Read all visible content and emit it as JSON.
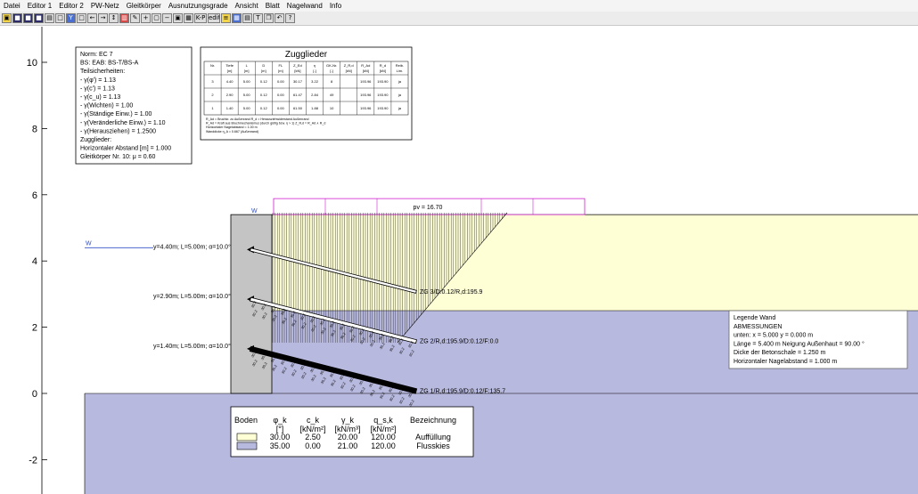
{
  "menu": [
    "Datei",
    "Editor 1",
    "Editor 2",
    "PW-Netz",
    "Gleitkörper",
    "Ausnutzungsgrade",
    "Ansicht",
    "Blatt",
    "Nagelwand",
    "Info"
  ],
  "toolbar_icons": [
    {
      "name": "open-folder-icon",
      "glyph": "▣",
      "style": "yel"
    },
    {
      "name": "save-icon",
      "glyph": "■",
      "style": "dark"
    },
    {
      "name": "save-as-icon",
      "glyph": "■",
      "style": "dark"
    },
    {
      "name": "save-all-icon",
      "glyph": "■",
      "style": "dark"
    },
    {
      "name": "print-icon",
      "glyph": "▤",
      "style": ""
    },
    {
      "name": "page-setup-icon",
      "glyph": "□",
      "style": ""
    },
    {
      "name": "y-tool-icon",
      "glyph": "Y",
      "style": "blue"
    },
    {
      "name": "box-tool-icon",
      "glyph": "□",
      "style": ""
    },
    {
      "name": "move-left-icon",
      "glyph": "←",
      "style": ""
    },
    {
      "name": "move-right-icon",
      "glyph": "→",
      "style": ""
    },
    {
      "name": "fit-icon",
      "glyph": "↕",
      "style": ""
    },
    {
      "name": "layers-icon",
      "glyph": "▥",
      "style": "red"
    },
    {
      "name": "pencil-icon",
      "glyph": "✎",
      "style": ""
    },
    {
      "name": "zoom-in-icon",
      "glyph": "+",
      "style": ""
    },
    {
      "name": "zoom-window-icon",
      "glyph": "▢",
      "style": ""
    },
    {
      "name": "zoom-out-icon",
      "glyph": "−",
      "style": ""
    },
    {
      "name": "zoom-fit-icon",
      "glyph": "▣",
      "style": ""
    },
    {
      "name": "grid-icon",
      "glyph": "▦",
      "style": ""
    },
    {
      "name": "kp-icon",
      "glyph": "K-P",
      "style": "wide"
    },
    {
      "name": "edit-icon",
      "glyph": "edit",
      "style": "wide"
    },
    {
      "name": "soil-layers-icon",
      "glyph": "≡",
      "style": "yel"
    },
    {
      "name": "table-icon",
      "glyph": "▦",
      "style": "blue"
    },
    {
      "name": "chart-icon",
      "glyph": "▤",
      "style": ""
    },
    {
      "name": "t-icon",
      "glyph": "T",
      "style": ""
    },
    {
      "name": "copy-icon",
      "glyph": "❐",
      "style": ""
    },
    {
      "name": "undo-icon",
      "glyph": "↶",
      "style": ""
    },
    {
      "name": "help-icon",
      "glyph": "?",
      "style": ""
    }
  ],
  "norm_box": [
    "Norm:  EC 7",
    "BS: EAB: BS-T/BS-A",
    "Teilsicherheiten:",
    " - γ(φ') = 1.13",
    " - γ(c') = 1.13",
    " - γ(c_u) = 1.13",
    " - γ(Wichten) = 1.00",
    " - γ(Ständige Einw.) = 1.00",
    " - γ(Veränderliche Einw.) = 1.10",
    " - γ(Herausziehen) = 1.2500",
    "Zugglieder:",
    "Horizontaler Abstand [m] = 1.000",
    "Gleitkörper Nr. 10: μ = 0.60"
  ],
  "zugglieder": {
    "title": "Zugglieder",
    "headers": [
      [
        "Nr.",
        ""
      ],
      [
        "Tiefe",
        "[m]"
      ],
      [
        "L",
        "[m]"
      ],
      [
        "D",
        "[m]"
      ],
      [
        "FL",
        "[m]"
      ],
      [
        "Z_Ed",
        "[kN]"
      ],
      [
        "η",
        "[-]"
      ],
      [
        "GK-Nr.",
        "[-]"
      ],
      [
        "Z_R,d",
        "[kN]"
      ],
      [
        "R_Ad",
        "[kN]"
      ],
      [
        "R_d",
        "[kN]"
      ],
      [
        "Reib.",
        "Lim."
      ]
    ],
    "rows": [
      [
        "3",
        "4.40",
        "5.00",
        "0.12",
        "0.00",
        "30.17",
        "3.22",
        "8",
        "",
        "193.96",
        "193.90",
        "ja"
      ],
      [
        "2",
        "2.90",
        "5.00",
        "0.12",
        "0.00",
        "61.47",
        "2.84",
        "49",
        "",
        "193.96",
        "193.90",
        "ja"
      ],
      [
        "1",
        "1.40",
        "5.00",
        "0.12",
        "0.00",
        "61.50",
        "1.88",
        "10",
        "",
        "193.96",
        "193.90",
        "ja"
      ]
    ],
    "notes": [
      "R_Ad = Bruchkr. zu Außenrand                       R_d = Herausziehwiderstand Außenrand",
      "R_Ad = Kraft aus Bruchmechanismus (durch gültig bzw. η > 1)     Z_R,d = R_Ad ∧ R_d",
      "Horizontaler Nagelabstand = 1.00 m",
      "Wanddicke η_A = 0.667 (Außenrand)"
    ]
  },
  "legend_wand": [
    "Legende Wand",
    "ABMESSUNGEN",
    "unten: x = 5.000    y = 0.000 m",
    "Länge = 5.400 m    Neigung Außenhaut = 90.00 °",
    "Dicke der Betonschale = 1.250 m",
    "Horizontaler Nagelabstand = 1.000 m"
  ],
  "soil_table": {
    "headers": [
      {
        "main": "Boden",
        "unit": ""
      },
      {
        "main": "φ_k",
        "unit": "[°]"
      },
      {
        "main": "c_k",
        "unit": "[kN/m²]"
      },
      {
        "main": "γ_k",
        "unit": "[kN/m³]"
      },
      {
        "main": "q_s,k",
        "unit": "[kN/m²]"
      },
      {
        "main": "Bezeichnung",
        "unit": ""
      }
    ],
    "rows": [
      {
        "color": "#ffffd6",
        "phi": "30.00",
        "c": "2.50",
        "gamma": "20.00",
        "q": "120.00",
        "name": "Auffüllung"
      },
      {
        "color": "#b8b9df",
        "phi": "35.00",
        "c": "0.00",
        "gamma": "21.00",
        "q": "120.00",
        "name": "Flusskies"
      }
    ]
  },
  "load_label": "pv = 16.70",
  "water_label": "W",
  "wall_label": "W",
  "nails": [
    {
      "y": 4.4,
      "label": "y=4.40m; L=5.00m; α=10.0°",
      "end_label": "ZG 3/D:0.12/R,d:195.9"
    },
    {
      "y": 2.9,
      "label": "y=2.90m; L=5.00m; α=10.0°",
      "end_label": "ZG 2/R,d:195.9/D:0.12/F:0.0"
    },
    {
      "y": 1.4,
      "label": "y=1.40m; L=5.00m; α=10.0°",
      "end_label": "ZG 1/R,d:195.9/D:0.12/F:135.7"
    }
  ],
  "bond_text": "30.2",
  "chart_data": {
    "type": "diagram",
    "y_ticks": [
      -2,
      0,
      2,
      4,
      6,
      8,
      10
    ],
    "ylim": [
      -3,
      11
    ],
    "ground_level": 0.0,
    "layer_boundary": 2.5,
    "terrain_top": 5.4,
    "water_level": 4.4,
    "wall": {
      "x_bottom": 5.0,
      "y_bottom": 0.0,
      "length": 5.4,
      "thickness": 1.25
    },
    "nail_inclination_deg": 10.0,
    "nail_length": 5.0
  }
}
